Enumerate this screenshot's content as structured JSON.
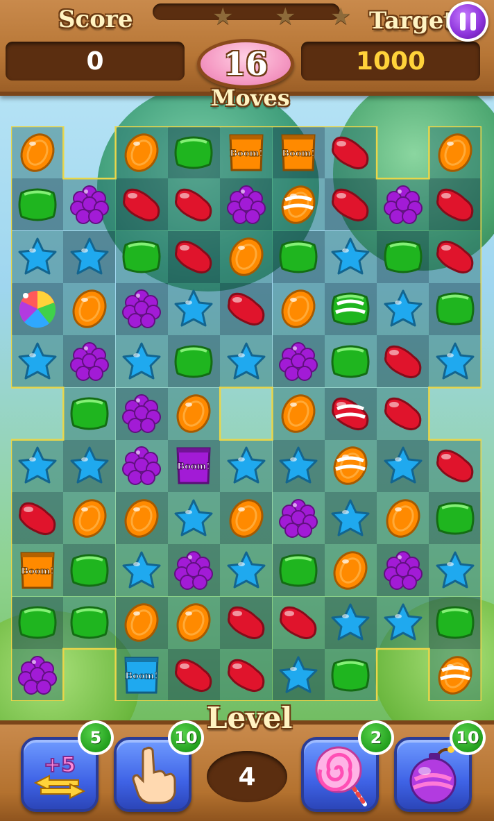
{
  "hud": {
    "score_label": "Score",
    "score_value": "0",
    "target_label": "Target",
    "target_value": "1000",
    "moves_value": "16",
    "moves_label": "Moves",
    "stars_earned": 0,
    "stars_total": 3
  },
  "level": {
    "label": "Level",
    "value": "4"
  },
  "boosters": [
    {
      "name": "extra-moves",
      "icon": "plus-five-arrows-icon",
      "text": "+5",
      "count": "5"
    },
    {
      "name": "hand",
      "icon": "pointing-hand-icon",
      "count": "10"
    },
    {
      "name": "lollipop",
      "icon": "lollipop-icon",
      "count": "2"
    },
    {
      "name": "bomb",
      "icon": "bomb-icon",
      "count": "10"
    }
  ],
  "colors": {
    "orange": "#ff8a00",
    "green": "#1fb51f",
    "red": "#e0142c",
    "purple": "#a21bd6",
    "blue": "#1fa9ef",
    "target_text": "#ffd23a",
    "score_text": "#ffffff"
  },
  "boost_label": "Boom!",
  "board": {
    "cols": 9,
    "rows": 11,
    "legend": {
      ".": "empty",
      "O": "orange-candy",
      "G": "green-candy",
      "R": "red-jelly-bean",
      "P": "purple-grape",
      "B": "blue-star",
      "W": "rainbow-candy",
      "o": "orange-striped-candy",
      "g": "green-striped-candy",
      "r": "red-striped-candy",
      "1": "orange-boom-bag",
      "2": "purple-boom-bag",
      "3": "blue-boom-bag"
    },
    "rows_data": [
      "O.OG11R.O",
      "GPRRPoRPR",
      "BBGROGBGR",
      "WOPBROgBG",
      "BPBGBPGRB",
      ".GPO.OrR.",
      "BBP2BBoBR",
      "ROOBOPBOG",
      "1GBPBGOPB",
      "GGOORRBBG",
      "P.3RRBG.o"
    ]
  }
}
